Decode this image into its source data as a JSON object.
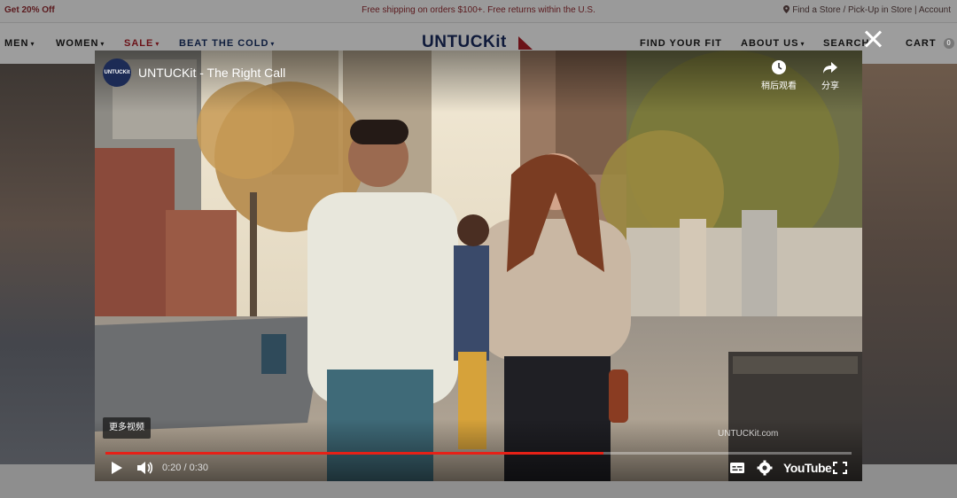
{
  "promo": {
    "left": "Get 20% Off",
    "center": "Free shipping on orders $100+. Free returns within the U.S.",
    "right": "Find a Store / Pick-Up in Store | Account"
  },
  "nav": {
    "left_items": [
      {
        "label": "MEN",
        "chevron": "▾"
      },
      {
        "label": "WOMEN",
        "chevron": "▾"
      },
      {
        "label": "SALE",
        "chevron": "▾"
      },
      {
        "label": "BEAT THE COLD",
        "chevron": "▾"
      }
    ],
    "logo": "UNTUCKit",
    "right_items": [
      {
        "label": "FIND YOUR FIT",
        "chevron": ""
      },
      {
        "label": "ABOUT US",
        "chevron": "▾"
      },
      {
        "label": "SEARCH",
        "chevron": ""
      },
      {
        "label": "CART",
        "chevron": ""
      }
    ],
    "cart_count": "0"
  },
  "player": {
    "channel_avatar": "UNTUCKit",
    "title": "UNTUCKit - The Right Call",
    "watch_later_label": "稍后观看",
    "share_label": "分享",
    "more_videos_label": "更多视频",
    "watermark": "UNTUCKit.com",
    "time": "0:20 / 0:30",
    "progress": 0.667,
    "youtube_label": "YouTube"
  },
  "colors": {
    "progress": "#e62117",
    "brand_navy": "#0f1a3a",
    "sale": "#6b1218"
  },
  "icons": {
    "close": "close-icon",
    "watch_later": "clock-icon",
    "share": "share-arrow-icon",
    "play": "play-icon",
    "volume": "volume-icon",
    "captions": "subtitles-icon",
    "settings": "gear-icon",
    "fullscreen": "fullscreen-icon",
    "location": "map-pin-icon"
  }
}
